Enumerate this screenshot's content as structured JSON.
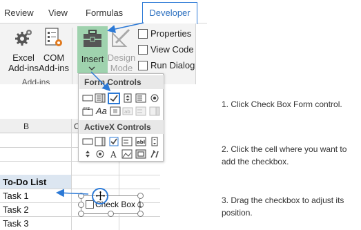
{
  "ribbon": {
    "tabs": [
      "Review",
      "View",
      "Formulas",
      "Developer"
    ],
    "buttons": {
      "excel_addins": [
        "Excel",
        "Add-ins"
      ],
      "com_addins": [
        "COM",
        "Add-ins"
      ],
      "insert": "Insert",
      "design_mode": [
        "Design",
        "Mode"
      ]
    },
    "group_label": "Add-ins",
    "menu": [
      "Properties",
      "View Code",
      "Run Dialog"
    ]
  },
  "dropdown": {
    "form_controls_title": "Form Controls",
    "activex_controls_title": "ActiveX Controls",
    "form_glyph_label": "Aa"
  },
  "sheet": {
    "col_labels": [
      "B",
      "C"
    ],
    "rows": [
      "To-Do List",
      "Task 1",
      "Task 2",
      "Task 3"
    ],
    "checkbox_label": "Check Box 1"
  },
  "instructions": [
    "1. Click Check Box Form control.",
    "2. Click the cell where you want to add the checkbox.",
    "3. Drag the checkbox to adjust its position."
  ],
  "colors": {
    "accent": "#2b79d6",
    "insert_highlight": "#9fd2ae",
    "header_fill": "#dce6f1"
  }
}
